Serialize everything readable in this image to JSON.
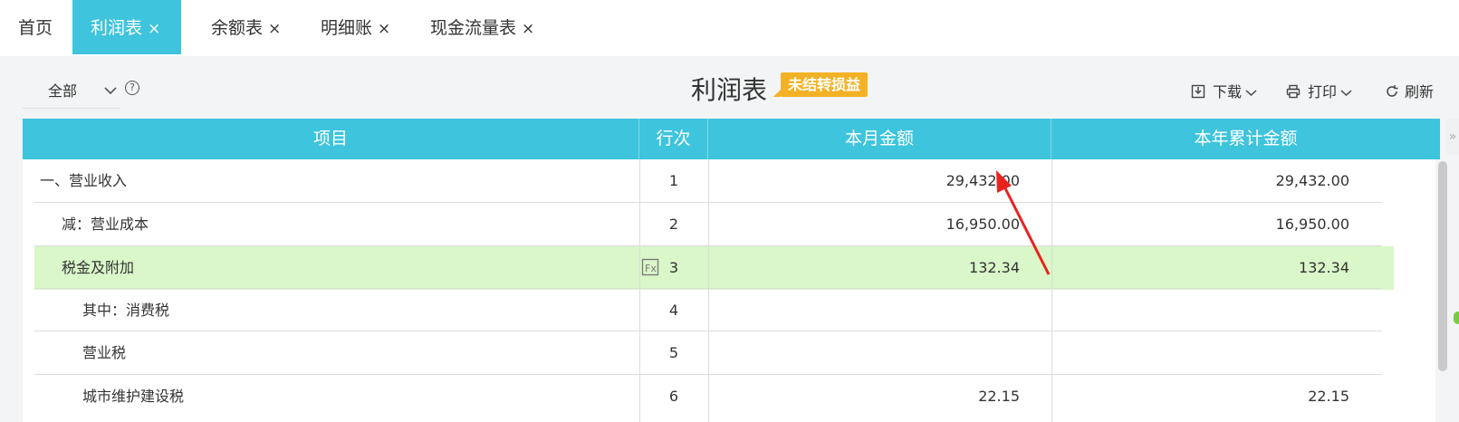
{
  "tabs": [
    {
      "label": "首页",
      "closable": false,
      "active": false
    },
    {
      "label": "利润表",
      "closable": true,
      "active": true
    },
    {
      "label": "余额表",
      "closable": true,
      "active": false
    },
    {
      "label": "明细账",
      "closable": true,
      "active": false
    },
    {
      "label": "现金流量表",
      "closable": true,
      "active": false
    }
  ],
  "close_glyph": "×",
  "toolbar": {
    "filter_value": "全部",
    "title": "利润表",
    "badge": "未结转损益",
    "download_label": "下载",
    "print_label": "打印",
    "refresh_label": "刷新"
  },
  "table": {
    "headers": [
      "项目",
      "行次",
      "本月金额",
      "本年累计金额"
    ],
    "rows": [
      {
        "item": "一、营业收入",
        "line": "1",
        "month": "29,432.00",
        "year": "29,432.00"
      },
      {
        "item": "减：营业成本",
        "line": "2",
        "month": "16,950.00",
        "year": "16,950.00"
      },
      {
        "item": "税金及附加",
        "line": "3",
        "month": "132.34",
        "year": "132.34"
      },
      {
        "item": "其中：消费税",
        "line": "4",
        "month": "",
        "year": ""
      },
      {
        "item": "营业税",
        "line": "5",
        "month": "",
        "year": ""
      },
      {
        "item": "城市维护建设税",
        "line": "6",
        "month": "22.15",
        "year": "22.15"
      }
    ]
  },
  "colors": {
    "accent": "#3ec4dc",
    "badge": "#f3b226",
    "highlight_row": "#d9f7c8",
    "arrow": "#e8231f"
  }
}
